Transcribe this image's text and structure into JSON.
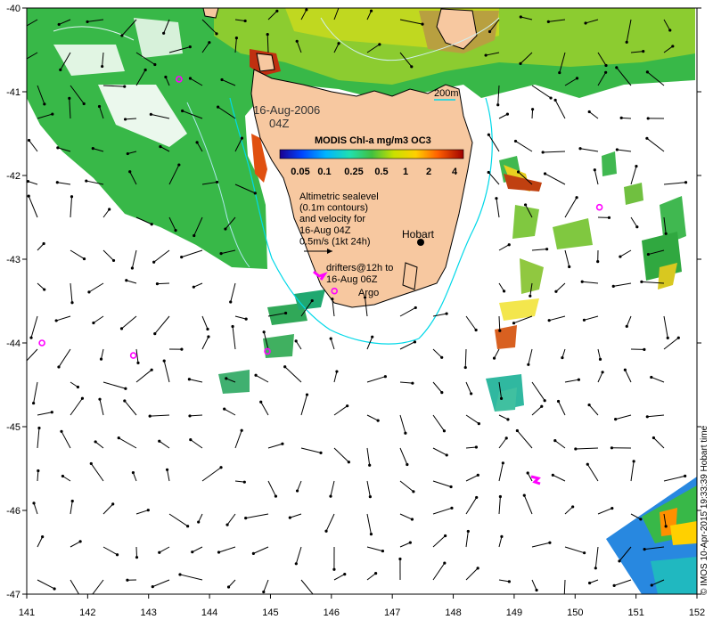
{
  "date_label": "16-Aug-2006",
  "time_label": "04Z",
  "colorbar": {
    "title": "MODIS Chl-a mg/m3 OC3",
    "ticks": [
      "0.05",
      "0.1",
      "0.25",
      "0.5",
      "1",
      "2",
      "4"
    ]
  },
  "scale_label": "200m",
  "notes": {
    "sealevel": [
      "Altimetric sealevel",
      "(0.1m contours)",
      "and velocity for",
      "16-Aug 04Z",
      "0.5m/s (1kt 24h)"
    ],
    "drifters": [
      "drifters@12h to",
      "16-Aug 06Z"
    ]
  },
  "place_labels": {
    "hobart": "Hobart",
    "argo": "Argo"
  },
  "axes": {
    "x_ticks": [
      "141",
      "142",
      "143",
      "144",
      "145",
      "146",
      "147",
      "148",
      "149",
      "150",
      "151",
      "152"
    ],
    "y_ticks": [
      "-40",
      "-41",
      "-42",
      "-43",
      "-44",
      "-45",
      "-46",
      "-47"
    ]
  },
  "credit": "© IMOS 10-Apr-2015 19:33:39 Hobart time",
  "argo_floats": [
    {
      "lon": 143.5,
      "lat": -40.85
    },
    {
      "lon": 146.05,
      "lat": -43.38
    },
    {
      "lon": 141.25,
      "lat": -44.0
    },
    {
      "lon": 142.75,
      "lat": -44.15
    },
    {
      "lon": 144.95,
      "lat": -44.1
    },
    {
      "lon": 150.4,
      "lat": -42.38
    }
  ],
  "colors": {
    "land": "#f7c8a0",
    "contour": "#00d8e8",
    "drifter": "#ff00ff",
    "vector": "#000000"
  }
}
